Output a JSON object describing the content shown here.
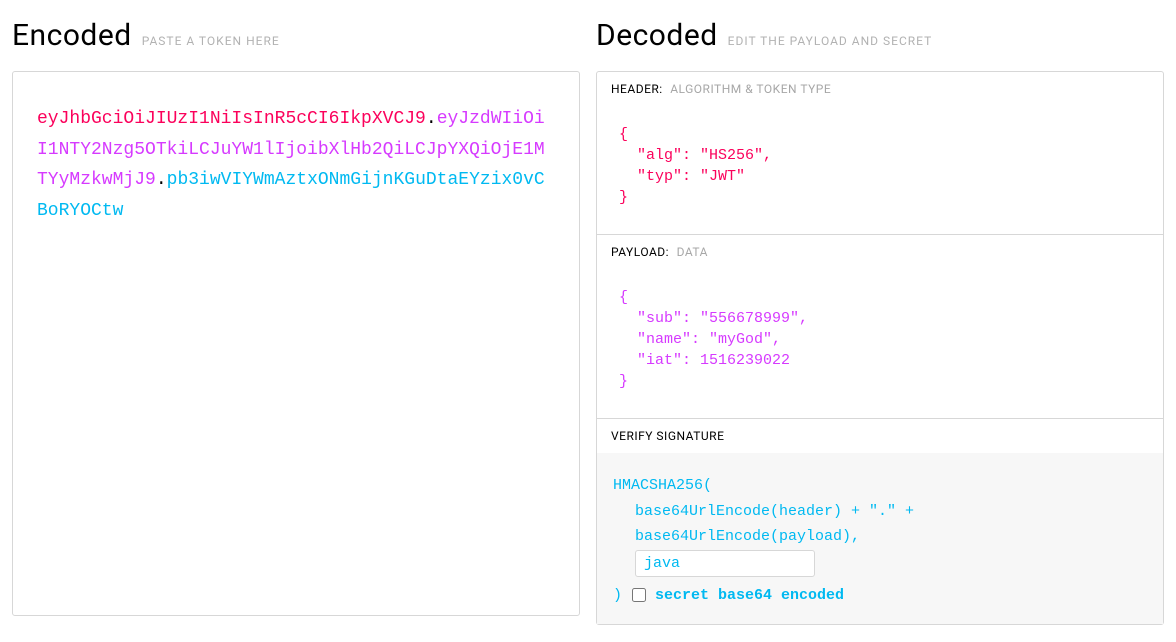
{
  "encoded": {
    "title": "Encoded",
    "hint": "PASTE A TOKEN HERE",
    "token_header": "eyJhbGciOiJIUzI1NiIsInR5cCI6IkpXVCJ9",
    "token_payload": "eyJzdWIiOiI1NTY2Nzg5OTkiLCJuYW1lIjoibXlHb2QiLCJpYXQiOjE1MTYyMzkwMjJ9",
    "token_signature": "pb3iwVIYWmAztxONmGijnKGuDtaEYzix0vCBoRYOCtw",
    "dot": "."
  },
  "decoded": {
    "title": "Decoded",
    "hint": "EDIT THE PAYLOAD AND SECRET",
    "header_section": {
      "label": "HEADER:",
      "sub": "ALGORITHM & TOKEN TYPE",
      "json": "{\n  \"alg\": \"HS256\",\n  \"typ\": \"JWT\"\n}"
    },
    "payload_section": {
      "label": "PAYLOAD:",
      "sub": "DATA",
      "json": "{\n  \"sub\": \"556678999\",\n  \"name\": \"myGod\",\n  \"iat\": 1516239022\n}"
    },
    "signature_section": {
      "label": "VERIFY SIGNATURE",
      "fn": "HMACSHA256(",
      "line2": "base64UrlEncode(header) + \".\" +",
      "line3": "base64UrlEncode(payload),",
      "secret_value": "java",
      "close": ")",
      "checkbox_label": "secret base64 encoded"
    }
  }
}
